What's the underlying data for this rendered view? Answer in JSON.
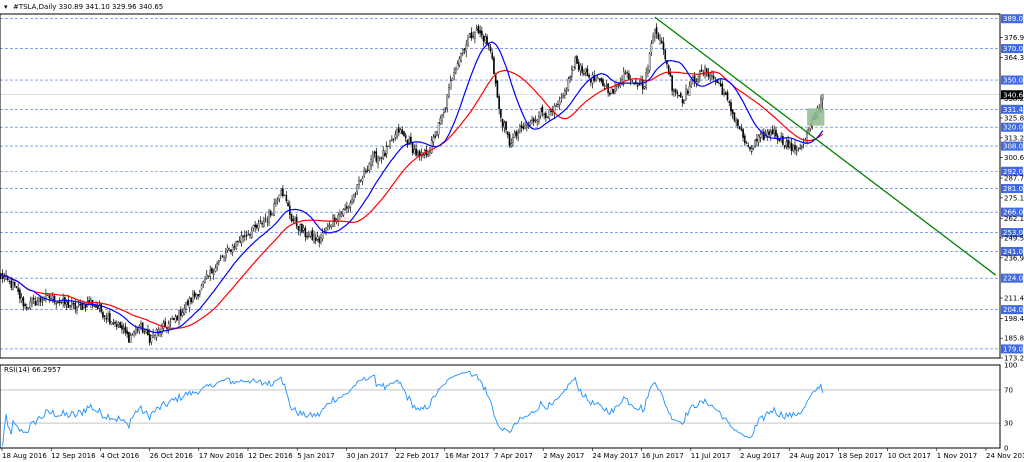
{
  "chart_data": {
    "type": "candlestick",
    "symbol": "#TSLA,Daily",
    "ohlc": {
      "open": "330.89",
      "high": "341.10",
      "low": "329.96",
      "close": "340.65"
    },
    "header_text": "#TSLA,Daily  330.89 341.10 329.96 340.65",
    "price_axis": {
      "ylim": [
        173.25,
        392.0
      ],
      "ticks": [
        376.95,
        364.35,
        338.25,
        325.85,
        313.25,
        300.65,
        287.7,
        275.1,
        262.1,
        249.55,
        236.95,
        211.4,
        198.45,
        185.85,
        173.25
      ]
    },
    "levels": [
      {
        "value": 389.0,
        "label": "389.00"
      },
      {
        "value": 370.0,
        "label": "370.00"
      },
      {
        "value": 350.0,
        "label": "350.00"
      },
      {
        "value": 331.4,
        "label": "331.40"
      },
      {
        "value": 320.0,
        "label": "320.00"
      },
      {
        "value": 308.0,
        "label": "308.00"
      },
      {
        "value": 292.0,
        "label": "292.00"
      },
      {
        "value": 281.0,
        "label": "281.00"
      },
      {
        "value": 266.0,
        "label": "266.00"
      },
      {
        "value": 253.0,
        "label": "253.00"
      },
      {
        "value": 241.0,
        "label": "241.00"
      },
      {
        "value": 224.0,
        "label": "224.00"
      },
      {
        "value": 204.0,
        "label": "204.00"
      },
      {
        "value": 179.0,
        "label": "179.00"
      }
    ],
    "current_price": {
      "value": 340.65,
      "label": "340.65"
    },
    "x_ticks": [
      "18 Aug 2016",
      "12 Sep 2016",
      "4 Oct 2016",
      "26 Oct 2016",
      "17 Nov 2016",
      "12 Dec 2016",
      "5 Jan 2017",
      "30 Jan 2017",
      "22 Feb 2017",
      "16 Mar 2017",
      "7 Apr 2017",
      "2 May 2017",
      "24 May 2017",
      "16 Jun 2017",
      "11 Jul 2017",
      "2 Aug 2017",
      "24 Aug 2017",
      "18 Sep 2017",
      "10 Oct 2017",
      "1 Nov 2017",
      "24 Nov 2017"
    ],
    "price_anchors": [
      [
        0,
        226
      ],
      [
        8,
        218
      ],
      [
        14,
        206
      ],
      [
        20,
        209
      ],
      [
        28,
        212
      ],
      [
        36,
        208
      ],
      [
        44,
        205
      ],
      [
        52,
        209
      ],
      [
        60,
        201
      ],
      [
        68,
        194
      ],
      [
        74,
        186
      ],
      [
        80,
        194
      ],
      [
        86,
        186
      ],
      [
        92,
        191
      ],
      [
        100,
        197
      ],
      [
        108,
        208
      ],
      [
        116,
        218
      ],
      [
        124,
        232
      ],
      [
        132,
        242
      ],
      [
        140,
        251
      ],
      [
        148,
        256
      ],
      [
        156,
        265
      ],
      [
        162,
        282
      ],
      [
        168,
        262
      ],
      [
        176,
        252
      ],
      [
        184,
        248
      ],
      [
        192,
        262
      ],
      [
        200,
        268
      ],
      [
        206,
        281
      ],
      [
        214,
        300
      ],
      [
        222,
        303
      ],
      [
        230,
        318
      ],
      [
        236,
        310
      ],
      [
        242,
        300
      ],
      [
        248,
        306
      ],
      [
        256,
        330
      ],
      [
        262,
        357
      ],
      [
        268,
        372
      ],
      [
        274,
        382
      ],
      [
        280,
        376
      ],
      [
        284,
        365
      ],
      [
        288,
        330
      ],
      [
        294,
        310
      ],
      [
        300,
        318
      ],
      [
        306,
        322
      ],
      [
        312,
        330
      ],
      [
        318,
        328
      ],
      [
        324,
        336
      ],
      [
        332,
        362
      ],
      [
        340,
        352
      ],
      [
        348,
        347
      ],
      [
        354,
        342
      ],
      [
        360,
        355
      ],
      [
        366,
        350
      ],
      [
        372,
        346
      ],
      [
        378,
        385
      ],
      [
        384,
        365
      ],
      [
        388,
        346
      ],
      [
        394,
        338
      ],
      [
        400,
        350
      ],
      [
        408,
        356
      ],
      [
        416,
        346
      ],
      [
        422,
        331
      ],
      [
        426,
        322
      ],
      [
        432,
        305
      ],
      [
        438,
        312
      ],
      [
        446,
        318
      ],
      [
        452,
        311
      ],
      [
        458,
        306
      ],
      [
        464,
        309
      ],
      [
        468,
        320
      ],
      [
        472,
        331
      ],
      [
        475,
        341
      ]
    ],
    "sma_fast": {
      "color": "#0000ff",
      "period": 20
    },
    "sma_slow": {
      "color": "#ff0000",
      "period": 40
    },
    "trendline": {
      "color": "#008000",
      "from": {
        "bar": 378,
        "price": 390
      },
      "to": {
        "bar": 575,
        "price": 226
      }
    },
    "zone": {
      "color": "#8fbc8f",
      "bars": [
        466,
        476
      ],
      "price": [
        321,
        332
      ]
    },
    "rsi": {
      "label": "RSI(14) 66.2957",
      "color": "#1e90ff",
      "ylim": [
        0,
        100
      ],
      "ticks": [
        {
          "value": 100,
          "label": "100"
        },
        {
          "value": 70,
          "label": "70"
        },
        {
          "value": 30,
          "label": "30"
        },
        {
          "value": 0,
          "label": "0"
        }
      ],
      "levels": [
        70,
        30
      ]
    }
  }
}
